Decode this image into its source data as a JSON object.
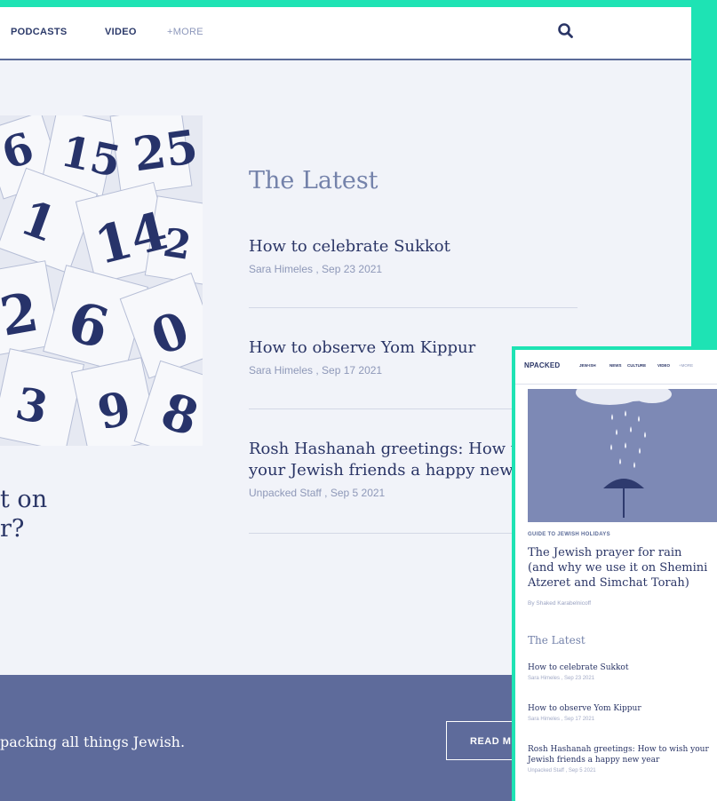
{
  "desktop": {
    "nav": {
      "items": [
        "PODCASTS",
        "VIDEO"
      ],
      "more": "+MORE",
      "search_icon": "search-icon"
    },
    "hero_title": "t on\nr?",
    "latest": {
      "heading": "The Latest",
      "articles": [
        {
          "title": "How to celebrate Sukkot",
          "meta": "Sara Himeles , Sep 23 2021"
        },
        {
          "title": "How to observe Yom Kippur",
          "meta": "Sara Himeles , Sep 17 2021"
        },
        {
          "title": "Rosh Hashanah greetings: How to\nyour Jewish friends a happy new",
          "meta": "Unpacked Staff , Sep 5 2021"
        }
      ]
    },
    "footer": {
      "tagline": "packing all things Jewish.",
      "button": "READ M"
    }
  },
  "mobile": {
    "logo": "NPACKED",
    "nav": [
      "JEW-ISH",
      "NEWS",
      "CULTURE",
      "VIDEO"
    ],
    "more": "+MORE",
    "category": "GUIDE TO JEWISH HOLIDAYS",
    "title": "The Jewish prayer for rain (and why we use it on Shemini Atzeret and Simchat Torah)",
    "byline": "By Shaked Karabelnicoff",
    "latest": {
      "heading": "The Latest",
      "articles": [
        {
          "title": "How to celebrate Sukkot",
          "meta": "Sara Himeles , Sep 23 2021"
        },
        {
          "title": "How to observe Yom Kippur",
          "meta": "Sara Himeles , Sep 17 2021"
        },
        {
          "title": "Rosh Hashanah greetings: How to wish your Jewish friends a happy new year",
          "meta": "Unpacked Staff , Sep 5 2021"
        }
      ]
    }
  },
  "colors": {
    "accent": "#1ee3b4",
    "navy": "#2a3566",
    "band": "#5e6b9b"
  }
}
